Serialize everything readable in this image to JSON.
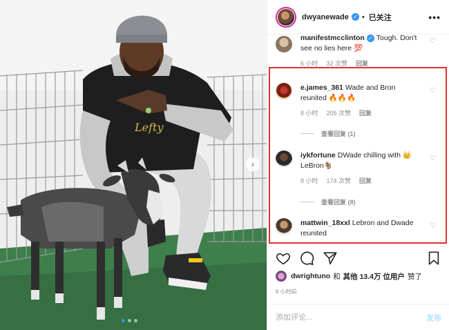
{
  "header": {
    "username": "dwyanewade",
    "follow_label": "已关注",
    "more_icon": "more-dots-icon",
    "verified_icon": "verified-badge-icon"
  },
  "comments": [
    {
      "user": "manifestmcclinton",
      "verified": true,
      "text": "Tough. Don't see no lies here 💯",
      "time": "6 小时",
      "likes": "32 次赞",
      "reply": "回复"
    },
    {
      "user": "e.james_361",
      "text": "Wade and Bron reunited 🔥🔥🔥",
      "time": "8 小时",
      "likes": "205 次赞",
      "reply": "回复",
      "view_replies": "查看回复 (1)"
    },
    {
      "user": "iykfortune",
      "text": "DWade chilling with 👑LeBron🐐",
      "time": "8 小时",
      "likes": "174 次赞",
      "reply": "回复",
      "view_replies": "查看回复 (8)"
    },
    {
      "user": "mattwin_18xxl",
      "text": "Lebron and Dwade reunited"
    }
  ],
  "actions": {
    "like_icon": "heart-outline-icon",
    "comment_icon": "comment-bubble-icon",
    "share_icon": "paper-plane-icon",
    "save_icon": "bookmark-icon"
  },
  "likes": {
    "user": "dwrightuno",
    "connector": "和",
    "others": "其他 13.4万 位用户",
    "suffix": "赞了"
  },
  "post_time": "8 小时前",
  "add_comment": {
    "placeholder": "添加评论...",
    "post_label": "发布"
  },
  "carousel": {
    "count": 3,
    "active_index": 0
  },
  "colors": {
    "accent": "#3897f0",
    "highlight": "#e0302a",
    "post_disabled": "#b2dffc"
  }
}
